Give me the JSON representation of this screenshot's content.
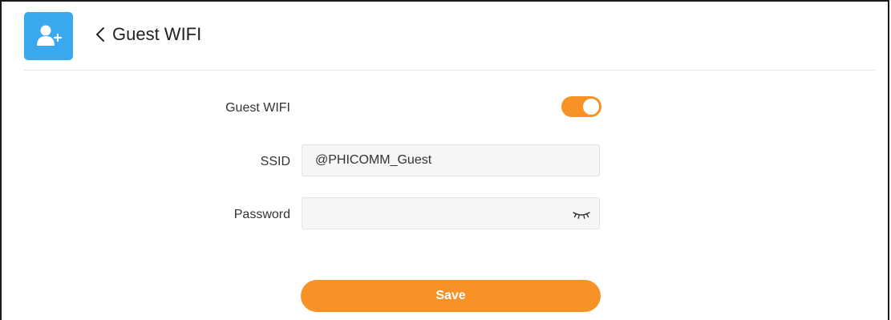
{
  "header": {
    "title": "Guest WIFI",
    "icon": "user-add-icon",
    "back_icon": "chevron-left-icon",
    "accent_color": "#3aa8ee"
  },
  "form": {
    "guest_wifi": {
      "label": "Guest WIFI",
      "enabled": true
    },
    "ssid": {
      "label": "SSID",
      "value": "@PHICOMM_Guest"
    },
    "password": {
      "label": "Password",
      "value": "",
      "visibility_icon": "eye-closed-icon"
    }
  },
  "actions": {
    "save_label": "Save"
  },
  "colors": {
    "primary": "#f79226",
    "field_background": "#f6f6f6"
  }
}
